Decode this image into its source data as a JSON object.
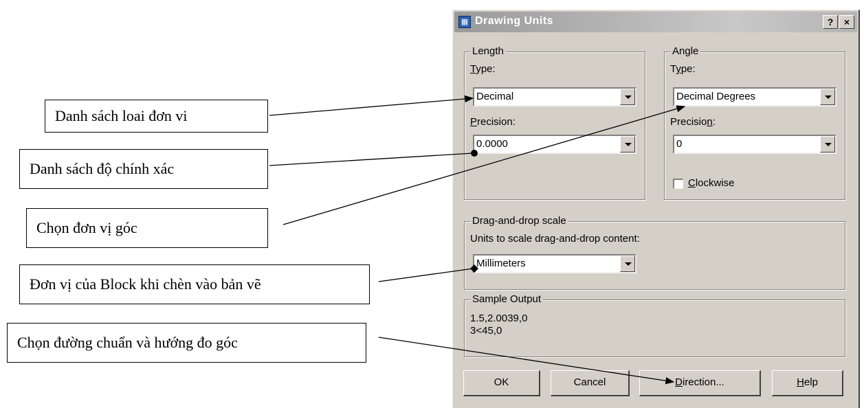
{
  "callouts": {
    "unit_type_list": "Danh sách loai đơn vi",
    "precision_list": "Danh sách độ chính xác",
    "angle_unit": "Chọn đơn vị góc",
    "block_unit": "Đơn vị của Block khi chèn vào bản vẽ",
    "direction": "Chọn đường chuẩn và hướng đo góc"
  },
  "dialog": {
    "title": "Drawing Units",
    "help_btn": "?",
    "close_btn": "×",
    "length": {
      "legend": "Length",
      "type_label_u": "T",
      "type_label_rest": "ype:",
      "type_value": "Decimal",
      "precision_label_u": "P",
      "precision_label_rest": "recision:",
      "precision_value": "0.0000"
    },
    "angle": {
      "legend": "Angle",
      "type_label_pre": "T",
      "type_label_u": "y",
      "type_label_rest": "pe:",
      "type_value": "Decimal Degrees",
      "precision_label_pre": "Precisio",
      "precision_label_u": "n",
      "precision_label_rest": ":",
      "precision_value": "0",
      "clockwise_u": "C",
      "clockwise_rest": "lockwise",
      "clockwise_checked": false
    },
    "drag_drop": {
      "legend": "Drag-and-drop scale",
      "units_label": "Units to scale drag-and-drop content:",
      "units_value": "Millimeters"
    },
    "sample": {
      "legend": "Sample Output",
      "line1": "1.5,2.0039,0",
      "line2": "3<45,0"
    },
    "buttons": {
      "ok": "OK",
      "cancel": "Cancel",
      "direction_u": "D",
      "direction_rest": "irection...",
      "help_u": "H",
      "help_rest": "elp"
    }
  }
}
